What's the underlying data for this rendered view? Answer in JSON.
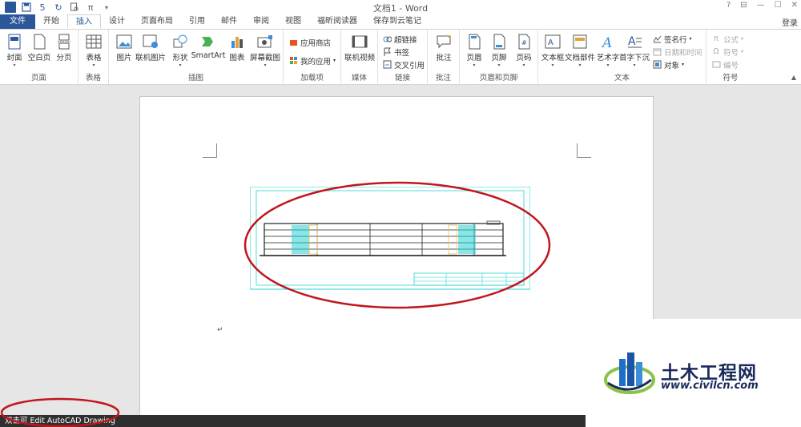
{
  "app": {
    "title": "文档1 - Word",
    "controls": [
      "?",
      "⊟",
      "—",
      "☐",
      "✕"
    ]
  },
  "qat": {
    "icons": [
      "word-logo-icon",
      "save-icon",
      "undo-icon",
      "redo-icon",
      "print-preview-icon",
      "equation-icon",
      "customize-icon"
    ],
    "undo": "5",
    "equation": "π"
  },
  "tabs": [
    "文件",
    "开始",
    "插入",
    "设计",
    "页面布局",
    "引用",
    "邮件",
    "审阅",
    "视图",
    "福昕阅读器",
    "保存到云笔记"
  ],
  "active_tab": "插入",
  "login": "登录",
  "ribbon": {
    "pages": {
      "label": "页面",
      "cover": "封面",
      "blank": "空白页",
      "break": "分页"
    },
    "tables": {
      "label": "表格",
      "table": "表格"
    },
    "illustrations": {
      "label": "插图",
      "picture": "图片",
      "online_picture": "联机图片",
      "shapes": "形状",
      "smartart": "SmartArt",
      "chart": "图表",
      "screenshot": "屏幕截图"
    },
    "addins": {
      "label": "加载项",
      "store": "应用商店",
      "my_apps": "我的应用"
    },
    "media": {
      "label": "媒体",
      "online_video": "联机视频"
    },
    "links": {
      "label": "链接",
      "hyperlink": "超链接",
      "bookmark": "书签",
      "cross_ref": "交叉引用"
    },
    "comments": {
      "label": "批注",
      "comment": "批注"
    },
    "header_footer": {
      "label": "页眉和页脚",
      "header": "页眉",
      "footer": "页脚",
      "page_number": "页码"
    },
    "text": {
      "label": "文本",
      "textbox": "文本框",
      "quick_parts": "文档部件",
      "wordart": "艺术字",
      "dropcap": "首字下沉",
      "signature": "签名行",
      "datetime": "日期和时间",
      "object": "对象"
    },
    "symbols": {
      "label": "符号",
      "equation": "公式",
      "symbol": "符号",
      "number": "编号"
    }
  },
  "document": {
    "paragraph_mark": "↵"
  },
  "status": {
    "text": "双击可 Edit AutoCAD Drawing"
  },
  "watermark": {
    "name": "土木工程网",
    "url": "www.civilcn.com"
  },
  "colors": {
    "accent": "#2b579a",
    "annotation": "#c0161c",
    "cad_cyan": "#28d2d2",
    "status_bg": "#2f2f2f"
  }
}
